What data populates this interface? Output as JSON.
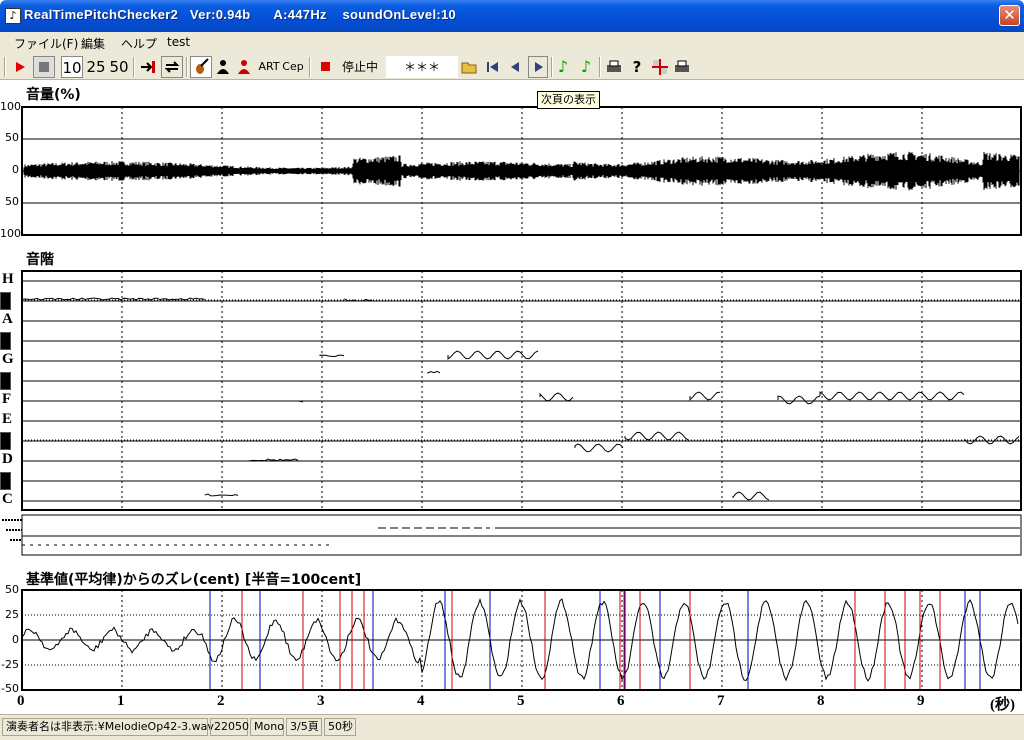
{
  "window": {
    "title": "RealTimePitchChecker2   Ver:0.94b      A:447Hz    soundOnLevel:10",
    "close_glyph": "✕",
    "icon_glyph": "♪"
  },
  "menu": [
    "ファイル(F)",
    "編集",
    "ヘルプ",
    "test"
  ],
  "toolbar": {
    "scale_10": "10",
    "scale_25": "25",
    "scale_50": "50",
    "art": "ART",
    "cep": "Cep",
    "status": "停止中",
    "stars": "＊＊＊"
  },
  "tooltip": "次頁の表示",
  "volume_panel": {
    "title": "音量(%)",
    "yticks": [
      "100",
      "50",
      "0",
      "50",
      "100"
    ]
  },
  "scale_panel": {
    "title": "音階",
    "notes": [
      "H",
      "A",
      "G",
      "F",
      "E",
      "D",
      "C"
    ]
  },
  "cent_panel": {
    "title": "基準値(平均律)からのズレ(cent) [半音=100cent]",
    "yticks": [
      "50",
      "25",
      "0",
      "-25",
      "-50"
    ]
  },
  "xaxis": {
    "ticks": [
      "0",
      "1",
      "2",
      "3",
      "4",
      "5",
      "6",
      "7",
      "8",
      "9"
    ],
    "unit": "(秒)"
  },
  "statusbar": {
    "performer": "演奏者名は非表示:¥MelodieOp42-3.wav",
    "rate": "22050",
    "channel": "Mono",
    "page": "3/5頁",
    "duration": "50秒"
  },
  "colors": {
    "titlebar": "#0550d8",
    "chrome": "#ece9d8",
    "cent_high": "#d00000",
    "cent_low": "#0000c0"
  }
}
